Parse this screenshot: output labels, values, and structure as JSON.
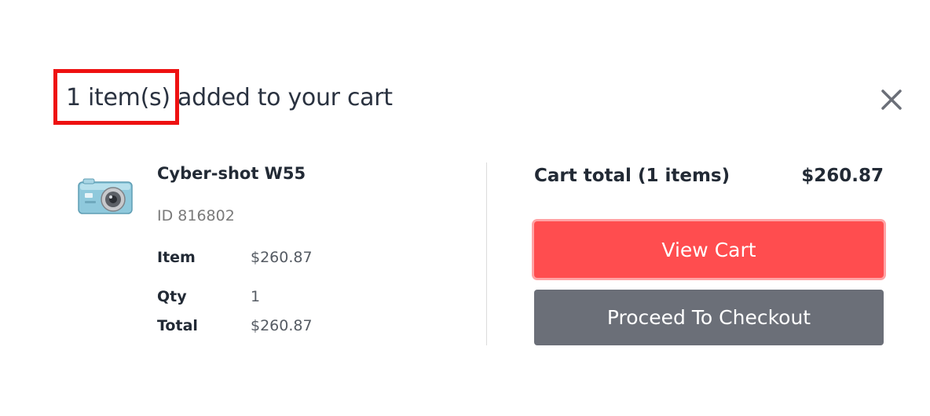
{
  "header": {
    "title_highlight": "1 item(s)",
    "title_rest": "added to your cart"
  },
  "product": {
    "name": "Cyber-shot W55",
    "id": "ID 816802",
    "image_icon": "camera-icon",
    "rows": [
      {
        "label": "Item",
        "value": "$260.87"
      },
      {
        "label": "Qty",
        "value": "1"
      },
      {
        "label": "Total",
        "value": "$260.87"
      }
    ]
  },
  "summary": {
    "cart_total_label": "Cart total (1 items)",
    "cart_total_value": "$260.87",
    "view_cart_label": "View Cart",
    "checkout_label": "Proceed To Checkout"
  },
  "colors": {
    "primary": "#ff4d4f",
    "secondary": "#6b6f78",
    "highlight_box": "#ee1111"
  },
  "icons": {
    "close": "close-icon"
  }
}
